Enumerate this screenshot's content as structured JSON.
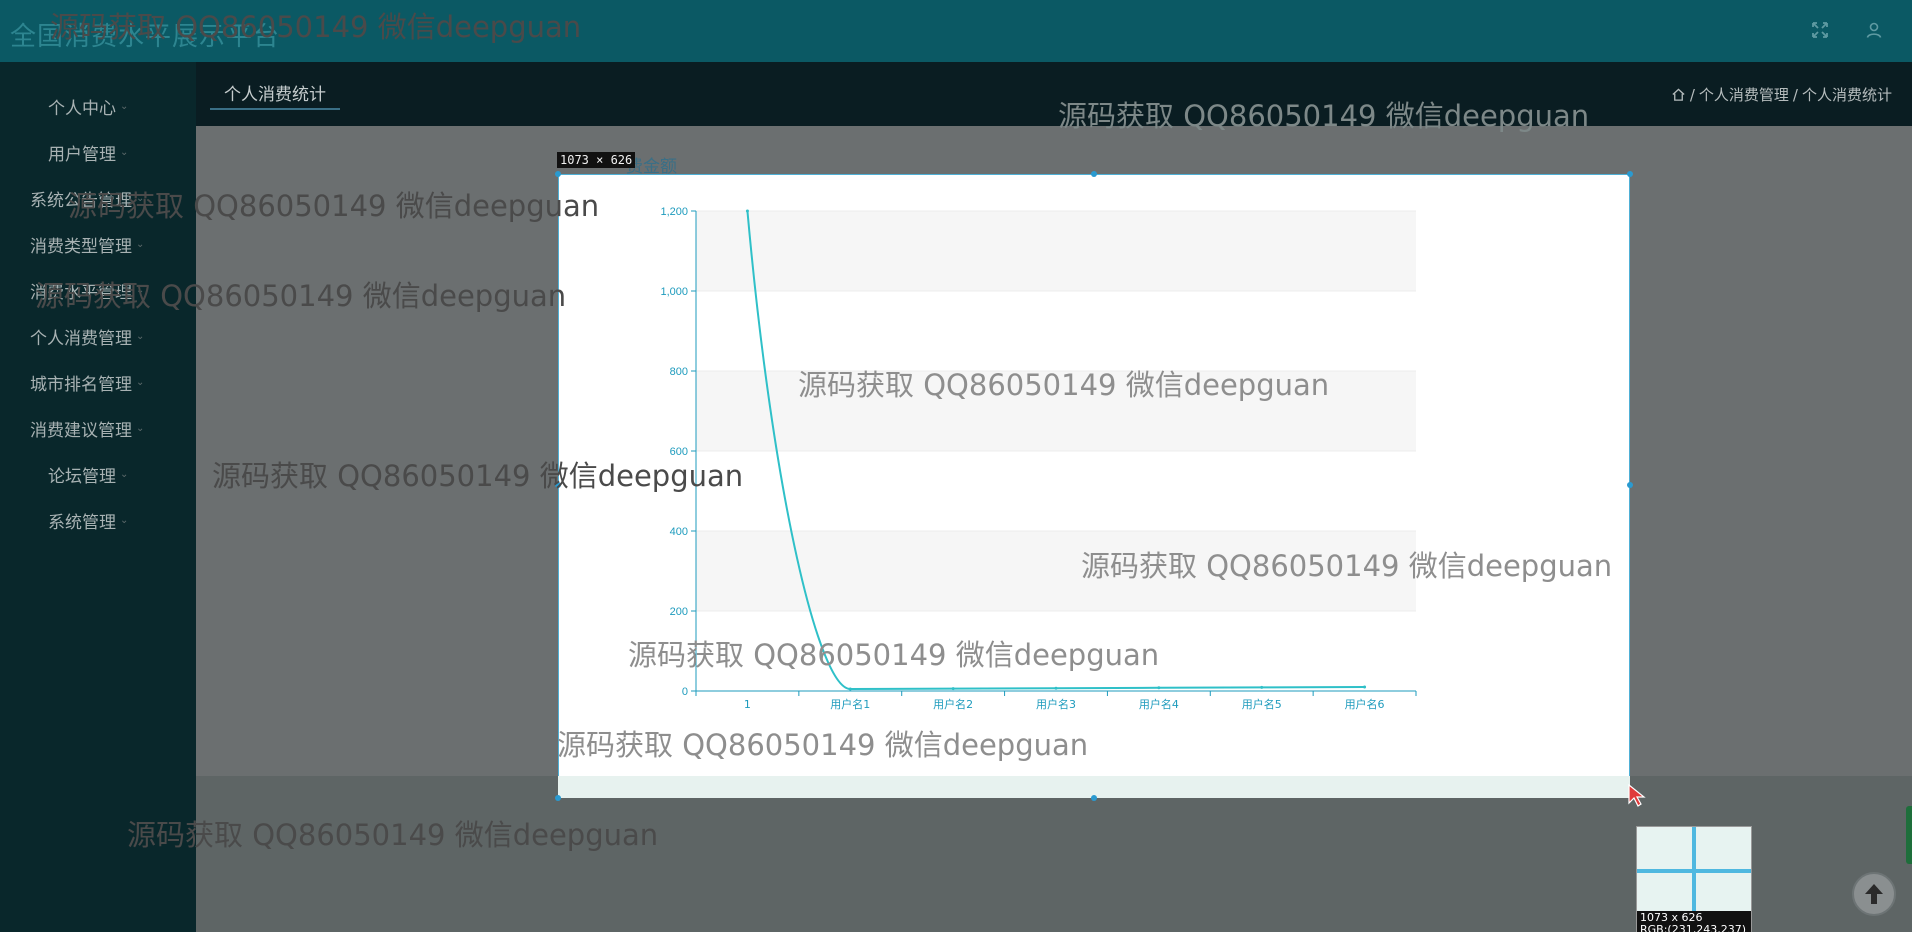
{
  "header": {
    "app_title": "全国消费水平展示平台",
    "icons": [
      "expand-icon",
      "user-icon"
    ]
  },
  "sidebar": {
    "items": [
      {
        "label": "个人中心"
      },
      {
        "label": "用户管理"
      },
      {
        "label": "系统公告管理"
      },
      {
        "label": "消费类型管理"
      },
      {
        "label": "消费水平管理"
      },
      {
        "label": "个人消费管理"
      },
      {
        "label": "城市排名管理"
      },
      {
        "label": "消费建议管理"
      },
      {
        "label": "论坛管理"
      },
      {
        "label": "系统管理"
      }
    ]
  },
  "content": {
    "active_tab": "个人消费统计",
    "breadcrumb": [
      "个人消费管理",
      "个人消费统计"
    ],
    "breadcrumb_sep": "/"
  },
  "capture": {
    "size_label": "1073 × 626",
    "magnifier_size": "1073 x 626",
    "magnifier_rgb": "RGB:(231,243,237)"
  },
  "chart_data": {
    "type": "line",
    "title_fragment": "费金额",
    "categories": [
      "1",
      "用户名1",
      "用户名2",
      "用户名3",
      "用户名4",
      "用户名5",
      "用户名6"
    ],
    "series": [
      {
        "values": [
          1200,
          5,
          6,
          7,
          8,
          9,
          10
        ]
      }
    ],
    "y_ticks": [
      "0",
      "200",
      "400",
      "600",
      "800",
      "1,000",
      "1,200"
    ],
    "ylim": [
      0,
      1200
    ],
    "smooth": true,
    "line_color": "#2fc0c8",
    "axis_color": "#1e9bbd",
    "grid": "alternating-bands"
  },
  "watermark": {
    "text": "源码获取 QQ86050149 微信deepguan"
  }
}
